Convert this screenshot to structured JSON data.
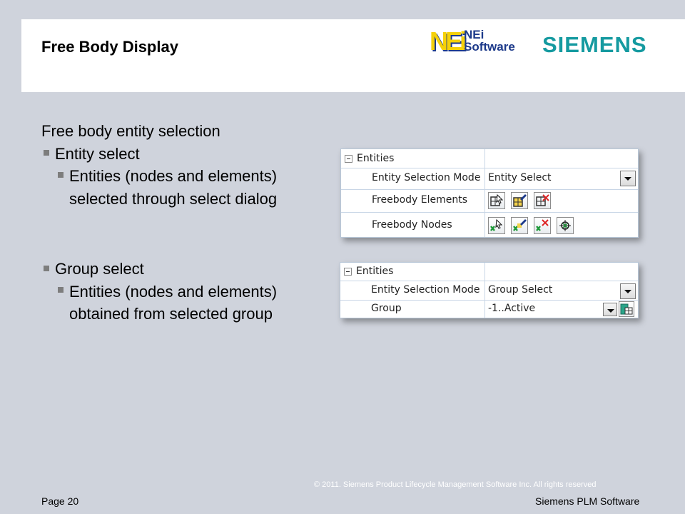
{
  "header": {
    "title": "Free Body Display",
    "nei_logo": {
      "mark": "NEi",
      "line1": "NEi",
      "line2": "Software"
    },
    "siemens_logo": "SIEMENS"
  },
  "content": {
    "heading": "Free body entity selection",
    "bullets": [
      {
        "label": "Entity select",
        "sub": [
          "Entities (nodes and elements)",
          "selected through select dialog"
        ]
      },
      {
        "label": "Group select",
        "sub": [
          "Entities (nodes and elements)",
          "obtained from selected group"
        ]
      }
    ]
  },
  "panel_entity": {
    "group": "Entities",
    "rows": [
      {
        "label": "Entity Selection Mode",
        "value": "Entity Select"
      },
      {
        "label": "Freebody Elements",
        "icons": [
          "select-elements-icon",
          "edit-elements-icon",
          "remove-elements-icon"
        ]
      },
      {
        "label": "Freebody Nodes",
        "icons": [
          "select-nodes-icon",
          "edit-nodes-icon",
          "remove-nodes-icon",
          "locate-nodes-icon"
        ]
      }
    ]
  },
  "panel_group": {
    "group": "Entities",
    "rows": [
      {
        "label": "Entity Selection Mode",
        "value": "Group Select"
      },
      {
        "label": "Group",
        "value": "-1..Active"
      }
    ]
  },
  "footer": {
    "copyright": "© 2011. Siemens Product Lifecycle Management Software Inc. All rights reserved",
    "page": "Page 20",
    "brand": "Siemens PLM Software"
  },
  "colors": {
    "background": "#cfd3dc",
    "siemens_teal": "#159aa0",
    "nei_yellow": "#f5d10a",
    "nei_blue": "#1d3a8a"
  }
}
